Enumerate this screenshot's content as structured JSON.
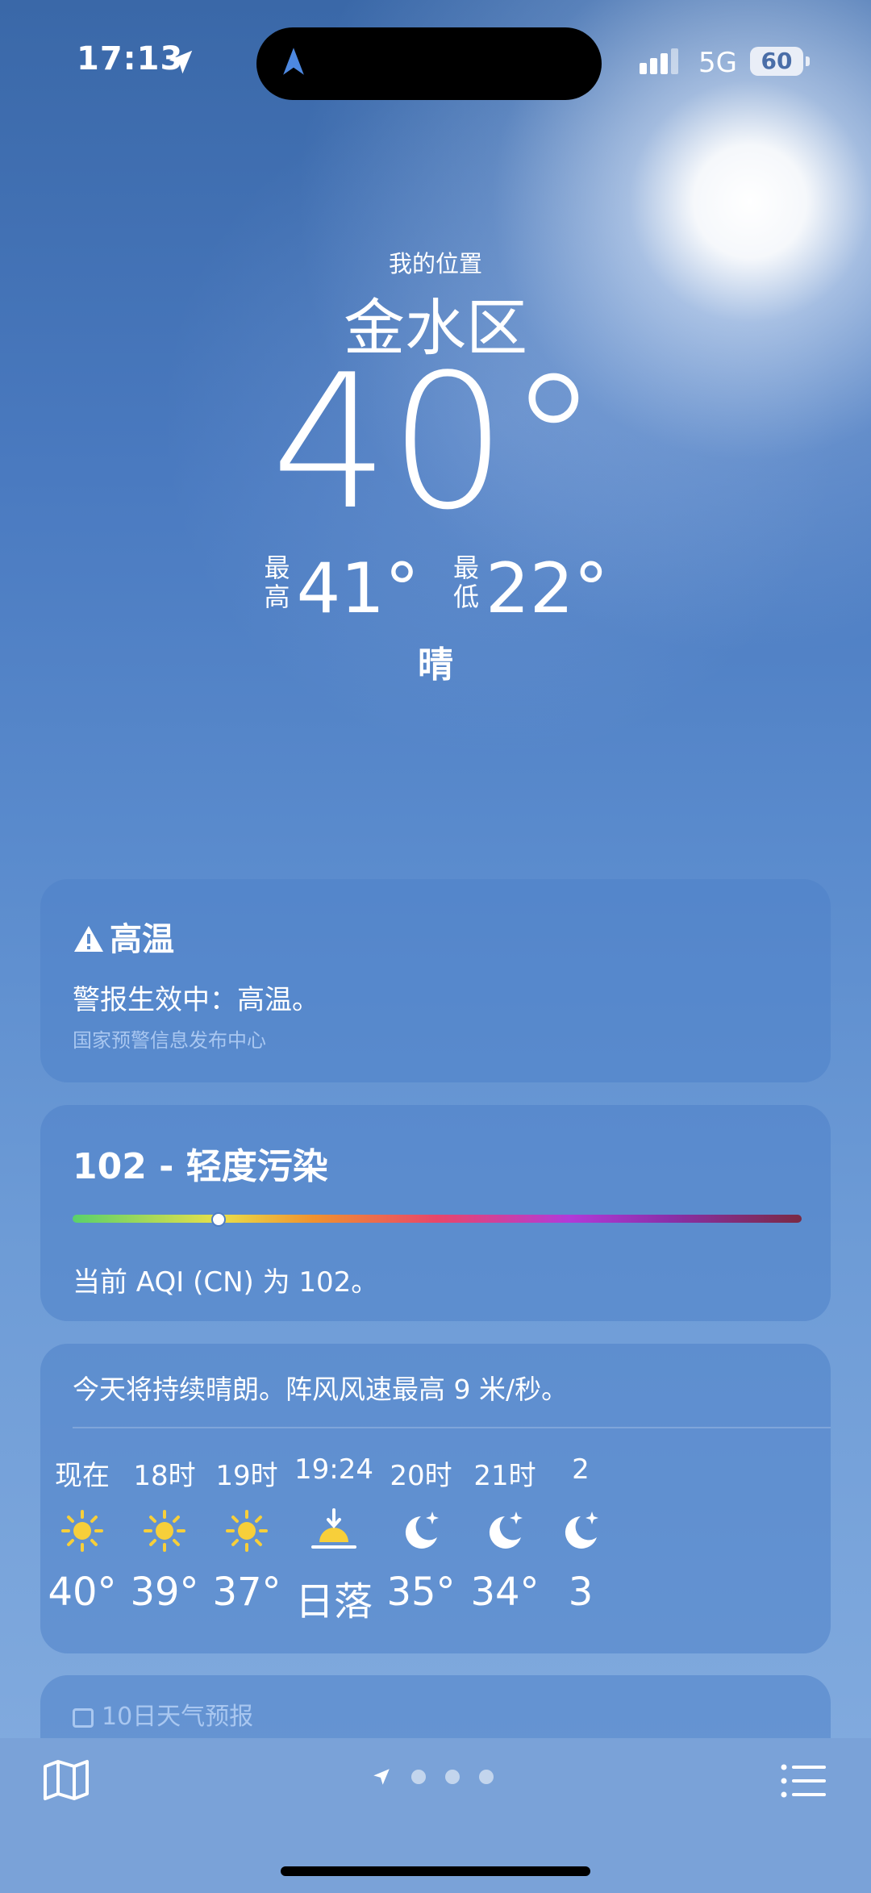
{
  "status_bar": {
    "time": "17:13",
    "network": "5G",
    "battery": "60"
  },
  "location": {
    "label": "我的位置",
    "city": "金水区"
  },
  "current": {
    "temperature": "40°",
    "high_label": "最高",
    "high": "41°",
    "low_label": "最低",
    "low": "22°",
    "condition": "晴"
  },
  "alert": {
    "title": "高温",
    "text": "警报生效中：高温。",
    "source": "国家预警信息发布中心"
  },
  "aqi": {
    "title": "102 - 轻度污染",
    "text": "当前 AQI (CN) 为 102。",
    "level_fraction": 0.2
  },
  "hourly": {
    "summary": "今天将持续晴朗。阵风风速最高 9 米/秒。",
    "items": [
      {
        "label": "现在",
        "icon": "sun-icon",
        "value": "40°"
      },
      {
        "label": "18时",
        "icon": "sun-icon",
        "value": "39°"
      },
      {
        "label": "19时",
        "icon": "sun-icon",
        "value": "37°"
      },
      {
        "label": "19:24",
        "icon": "sunset-icon",
        "value": "日落"
      },
      {
        "label": "20时",
        "icon": "moon-stars-icon",
        "value": "35°"
      },
      {
        "label": "21时",
        "icon": "moon-stars-icon",
        "value": "34°"
      },
      {
        "label": "2",
        "icon": "moon-stars-icon",
        "value": "3"
      }
    ]
  },
  "forecast": {
    "title": "10日天气预报"
  },
  "colors": {
    "sun": "#f7cf3a",
    "accent_blue": "#4d88e0"
  }
}
